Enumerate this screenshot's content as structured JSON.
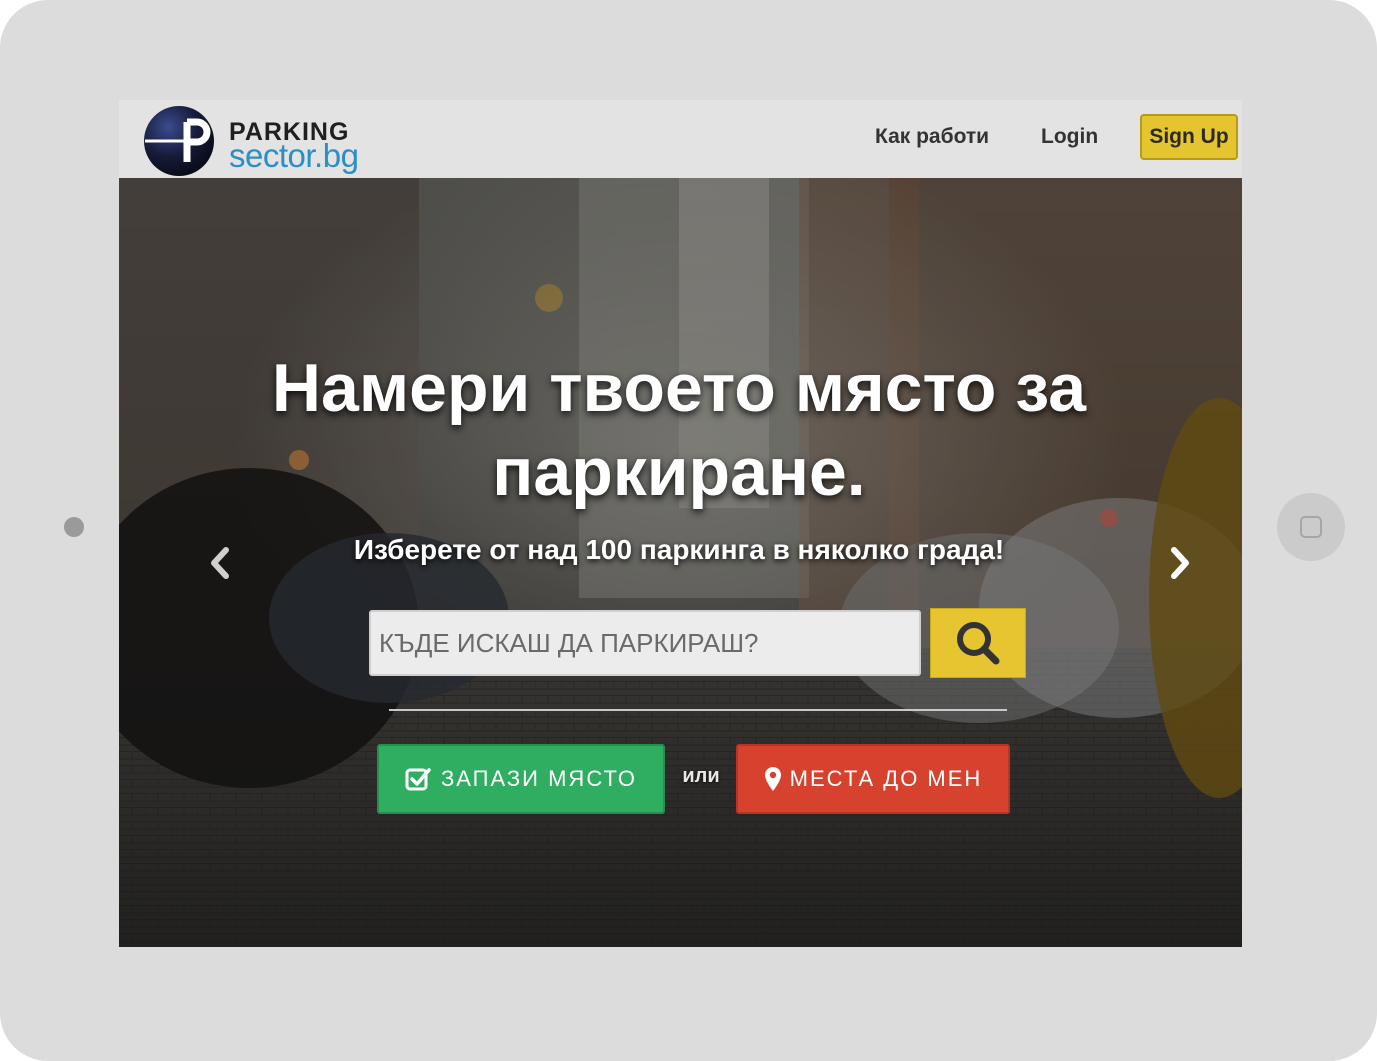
{
  "logo": {
    "line1": "PARKING",
    "line2": "sector.bg"
  },
  "nav": {
    "how_it_works": "Как работи",
    "login": "Login",
    "signup": "Sign Up"
  },
  "hero": {
    "title": "Намери твоето място за паркиране.",
    "subtitle": "Изберете от над 100 паркинга в няколко града!",
    "search_placeholder": "КЪДЕ ИСКАШ ДА ПАРКИРАШ?",
    "reserve_label": "ЗАПАЗИ МЯСТО",
    "or_label": "или",
    "nearby_label": "МЕСТА ДО МЕН"
  },
  "icons": {
    "search": "search-icon",
    "reserve": "check-square-icon",
    "nearby": "map-marker-icon",
    "prev": "chevron-left-icon",
    "next": "chevron-right-icon"
  },
  "colors": {
    "accent_yellow": "#e4c530",
    "logo_blue": "#2a8fc6",
    "reserve_green": "#2fae62",
    "nearby_red": "#d6422e"
  }
}
